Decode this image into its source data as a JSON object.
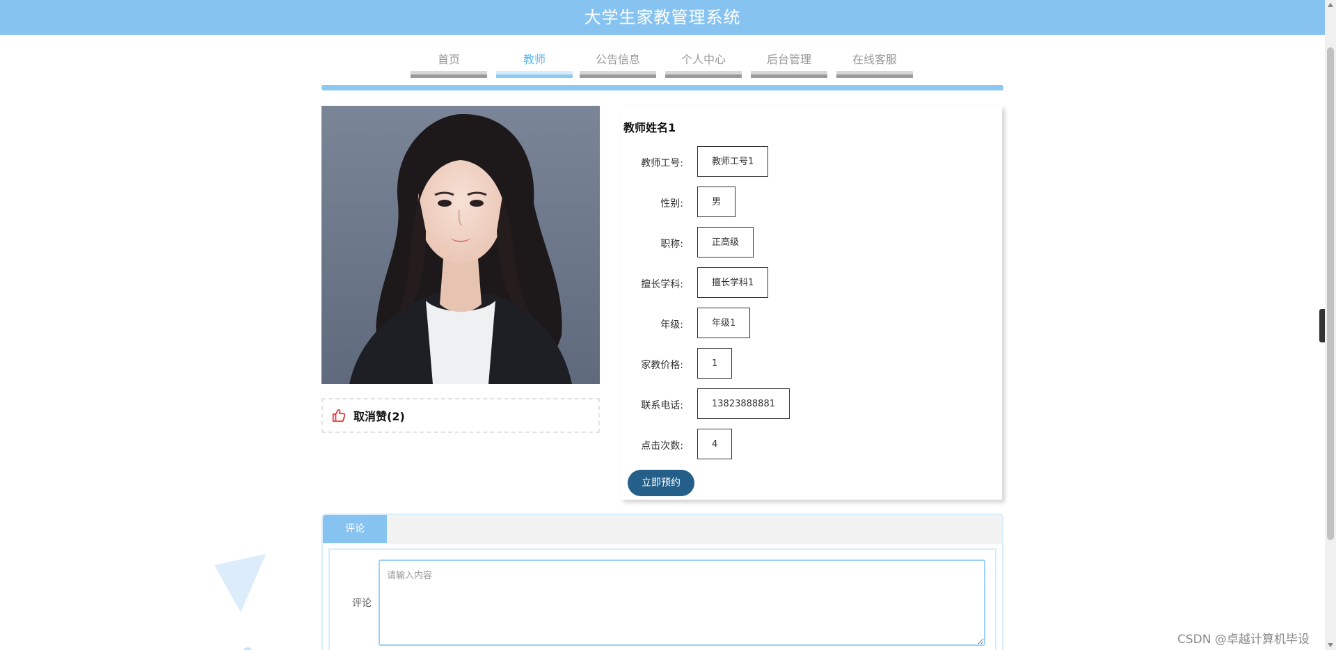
{
  "app": {
    "title": "大学生家教管理系统"
  },
  "nav": {
    "items": [
      {
        "label": "首页",
        "active": false
      },
      {
        "label": "教师",
        "active": true
      },
      {
        "label": "公告信息",
        "active": false
      },
      {
        "label": "个人中心",
        "active": false
      },
      {
        "label": "后台管理",
        "active": false
      },
      {
        "label": "在线客服",
        "active": false
      }
    ]
  },
  "like": {
    "label": "取消赞(2)",
    "icon": "thumbs-up-icon",
    "color": "#e4393c"
  },
  "teacher": {
    "name": "教师姓名1",
    "fields": [
      {
        "label": "教师工号:",
        "value": "教师工号1"
      },
      {
        "label": "性别:",
        "value": "男"
      },
      {
        "label": "职称:",
        "value": "正高级"
      },
      {
        "label": "擅长学科:",
        "value": "擅长学科1"
      },
      {
        "label": "年级:",
        "value": "年级1"
      },
      {
        "label": "家教价格:",
        "value": "1"
      },
      {
        "label": "联系电话:",
        "value": "13823888881"
      },
      {
        "label": "点击次数:",
        "value": "4"
      }
    ],
    "book_button": "立即预约"
  },
  "comments": {
    "tab_label": "评论",
    "field_label": "评论",
    "placeholder": "请输入内容"
  },
  "watermark": "CSDN @卓越计算机毕设",
  "colors": {
    "primary": "#87c3f1",
    "button": "#245f8a"
  }
}
